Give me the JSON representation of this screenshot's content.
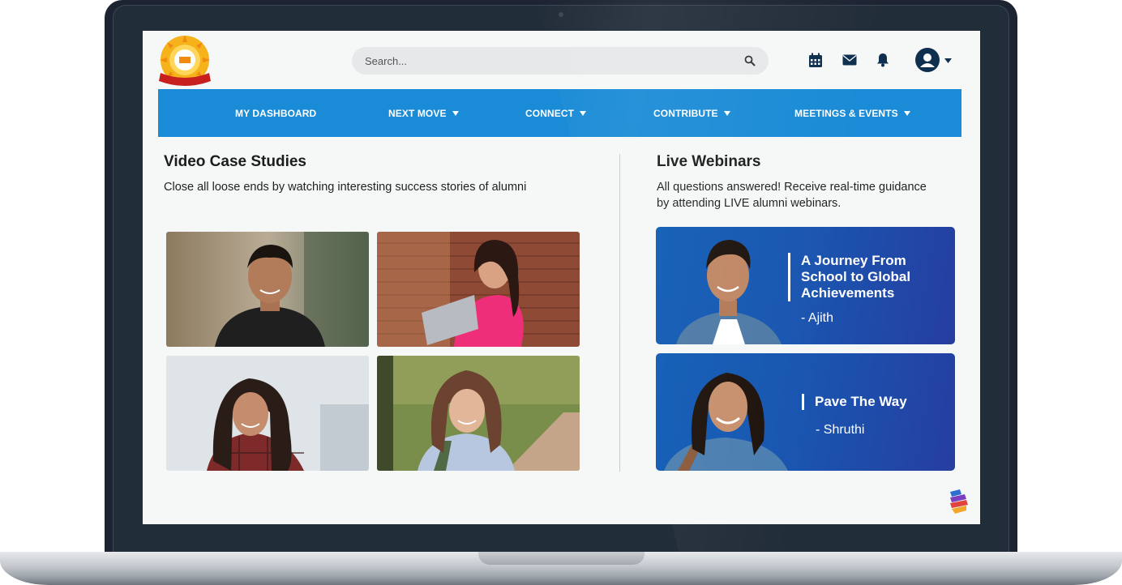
{
  "header": {
    "logo_icon": "school-logo",
    "search": {
      "placeholder": "Search..."
    },
    "icons": [
      "calendar-icon",
      "mail-icon",
      "bell-icon",
      "user-avatar-icon",
      "caret-down-icon"
    ]
  },
  "nav": {
    "items": [
      {
        "label": "MY DASHBOARD",
        "has_dropdown": false
      },
      {
        "label": "NEXT MOVE",
        "has_dropdown": true
      },
      {
        "label": "CONNECT",
        "has_dropdown": true
      },
      {
        "label": "CONTRIBUTE",
        "has_dropdown": true
      },
      {
        "label": "MEETINGS & EVENTS",
        "has_dropdown": true
      }
    ]
  },
  "video_case_studies": {
    "title": "Video Case Studies",
    "description": "Close all loose ends by watching interesting success stories of alumni",
    "videos": [
      {
        "thumbnail": "young-man-portrait"
      },
      {
        "thumbnail": "woman-with-laptop-portrait"
      },
      {
        "thumbnail": "woman-plaid-shirt-portrait"
      },
      {
        "thumbnail": "woman-in-park-portrait"
      }
    ]
  },
  "live_webinars": {
    "title": "Live Webinars",
    "description_line1": "All questions answered! Receive real-time guidance",
    "description_line2": "by attending LIVE alumni webinars.",
    "webinars": [
      {
        "title_line1": "A Journey From",
        "title_line2": "School to Global",
        "title_line3": "Achievements",
        "speaker": "- Ajith"
      },
      {
        "title_line1": "Pave The Way",
        "speaker": "- Shruthi"
      }
    ]
  },
  "colors": {
    "nav_bg": "#1a8bd6",
    "webinar_card_start": "#0d5bb5",
    "webinar_card_end": "#263ea0",
    "avatar_bg": "#0f2f4f",
    "screen_bg": "#f6f8f8"
  }
}
